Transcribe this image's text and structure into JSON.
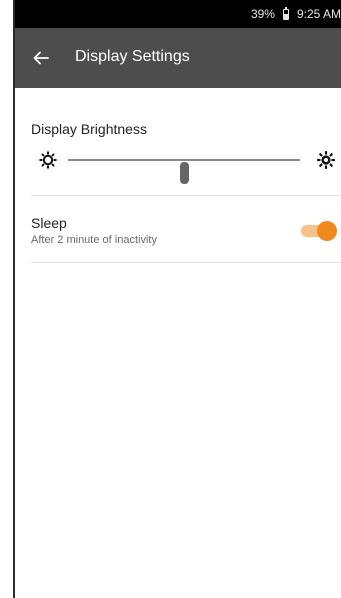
{
  "status_bar": {
    "battery_percent": "39%",
    "time": "9:25 AM"
  },
  "app_bar": {
    "back_icon": "arrow-left-icon",
    "title": "Display Settings"
  },
  "brightness": {
    "label": "Display Brightness",
    "level": 0.5,
    "min_icon": "brightness-low-icon",
    "max_icon": "brightness-high-icon"
  },
  "sleep": {
    "title": "Sleep",
    "subtitle": "After 2 minute of inactivity",
    "enabled": true,
    "toggle_color": "#f08a1e"
  },
  "colors": {
    "app_bar": "#4d4d4d",
    "status_bar": "#000000",
    "accent": "#f08a1e"
  }
}
